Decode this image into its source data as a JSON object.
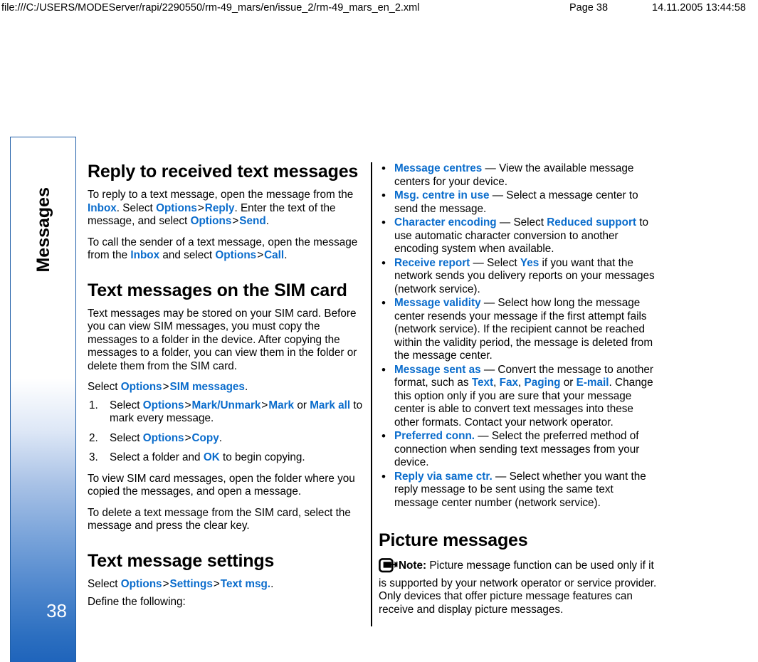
{
  "print_header": {
    "url": "file:///C:/USERS/MODEServer/rapi/2290550/rm-49_mars/en/issue_2/rm-49_mars_en_2.xml",
    "page_label": "Page 38",
    "datetime": "14.11.2005 13:44:58"
  },
  "sidebar": {
    "chapter_label": "Messages",
    "page_number": "38",
    "accent_color": "#1f64bb",
    "border_color": "#1f5fa8"
  },
  "link_color": "#0a6ccc",
  "left_column": {
    "heading_1": "Reply to received text messages",
    "para_1": {
      "t1": "To reply to a text message, open the message from the ",
      "l1": "Inbox",
      "t2": ". Select ",
      "l2": "Options",
      "gt1": ">",
      "l3": "Reply",
      "t3": ". Enter the text of the message, and select ",
      "l4": "Options",
      "gt2": ">",
      "l5": "Send",
      "t4": "."
    },
    "para_2": {
      "t1": "To call the sender of a text message, open the message from the ",
      "l1": "Inbox",
      "t2": " and select ",
      "l2": "Options",
      "gt1": ">",
      "l3": "Call",
      "t3": "."
    },
    "heading_2": "Text messages on the SIM card",
    "para_3": "Text messages may be stored on your SIM card. Before you can view SIM messages, you must copy the messages to a folder in the device. After copying the messages to a folder, you can view them in the folder or delete them from the SIM card.",
    "para_4": {
      "t1": "Select ",
      "l1": "Options",
      "gt1": ">",
      "l2": "SIM messages",
      "t2": "."
    },
    "steps": [
      {
        "num": "1.",
        "t1": "Select ",
        "l1": "Options",
        "gt1": ">",
        "l2": "Mark/Unmark",
        "gt2": ">",
        "l3": "Mark",
        "t2": " or ",
        "l4": "Mark all",
        "t3": " to mark every message."
      },
      {
        "num": "2.",
        "t1": "Select ",
        "l1": "Options",
        "gt1": ">",
        "l2": "Copy",
        "t2": "."
      },
      {
        "num": "3.",
        "t1": "Select a folder and ",
        "l1": "OK",
        "t2": " to begin copying."
      }
    ],
    "para_5": "To view SIM card messages, open the folder where you copied the messages, and open a message.",
    "para_6": "To delete a text message from the SIM card, select the message and press the clear key.",
    "heading_3": "Text message settings",
    "para_7": {
      "t1": "Select ",
      "l1": "Options",
      "gt1": ">",
      "l2": "Settings",
      "gt2": ">",
      "l3": "Text msg.",
      "t2": "."
    },
    "para_8": "Define the following:"
  },
  "right_column": {
    "bullets": [
      {
        "term": "Message centres",
        "dash": " — ",
        "t1": "View the available message centers for your device."
      },
      {
        "term": "Msg. centre in use",
        "dash": " — ",
        "t1": "Select a message center to send the message."
      },
      {
        "term": "Character encoding",
        "dash": " — ",
        "t1": "Select ",
        "l1": "Reduced support",
        "t2": " to use automatic character conversion to another encoding system when available."
      },
      {
        "term": "Receive report",
        "dash": " — ",
        "t1": "Select ",
        "l1": "Yes",
        "t2": " if you want that the network sends you delivery reports on your messages (network service)."
      },
      {
        "term": "Message validity",
        "dash": " — ",
        "t1": "Select how long the message center resends your message if the first attempt fails (network service). If the recipient cannot be reached within the validity period, the message is deleted from the message center."
      },
      {
        "term": "Message sent as",
        "dash": " — ",
        "t1": "Convert the message to another format, such as ",
        "l1": "Text",
        "sep1": ", ",
        "l2": "Fax",
        "sep2": ", ",
        "l3": "Paging",
        "sep3": " or ",
        "l4": "E-mail",
        "t2": ". Change this option only if you are sure that your message center is able to convert text messages into these other formats. Contact your network operator."
      },
      {
        "term": "Preferred conn.",
        "dash": " — ",
        "t1": "Select the preferred method of connection when sending text messages from your device."
      },
      {
        "term": "Reply via same ctr.",
        "dash": " — ",
        "t1": "Select whether you want the reply message to be sent using the same text message center number (network service)."
      }
    ],
    "heading_1": "Picture messages",
    "note": {
      "label": "Note:",
      "text": " Picture message function can be used only if it is supported by your network operator or service provider. Only devices that offer picture message features can receive and display picture messages."
    }
  }
}
